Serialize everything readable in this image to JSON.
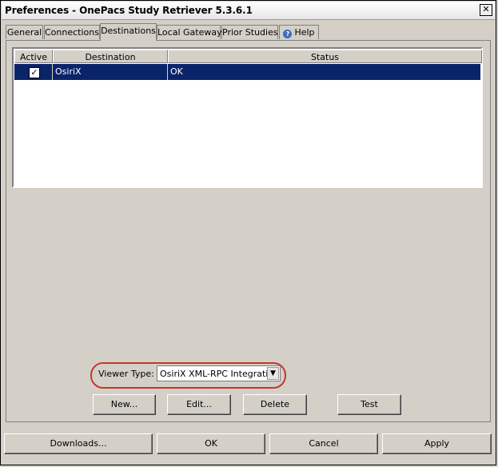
{
  "window": {
    "title": "Preferences - OnePacs Study Retriever 5.3.6.1",
    "close_label": "✕"
  },
  "tabs": [
    {
      "label": "General"
    },
    {
      "label": "Connections"
    },
    {
      "label": "Destinations",
      "active": true
    },
    {
      "label": "Local Gateway"
    },
    {
      "label": "Prior Studies"
    },
    {
      "label": "Help",
      "icon": "help-icon"
    }
  ],
  "table": {
    "columns": [
      "Active",
      "Destination",
      "Status"
    ],
    "rows": [
      {
        "active": true,
        "destination": "OsiriX",
        "status": "OK"
      }
    ]
  },
  "viewer": {
    "label": "Viewer Type:",
    "value": "OsiriX XML-RPC Integration",
    "highlight_color": "#c0392b"
  },
  "destination_buttons": {
    "new": "New...",
    "edit": "Edit...",
    "delete": "Delete",
    "test": "Test"
  },
  "footer": {
    "downloads": "Downloads...",
    "ok": "OK",
    "cancel": "Cancel",
    "apply": "Apply"
  },
  "colors": {
    "selection": "#0a246a",
    "face": "#d4d0c8"
  }
}
